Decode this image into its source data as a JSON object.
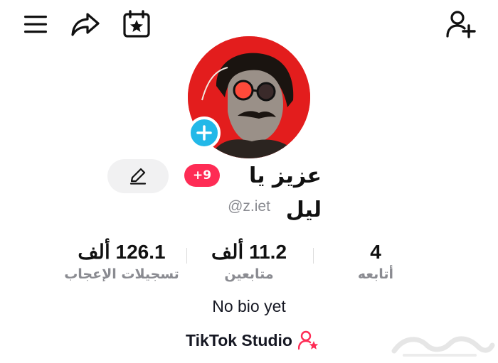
{
  "top_bar": {
    "menu_icon": "hamburger-menu-icon",
    "share_icon": "share-arrow-icon",
    "calendar_icon": "calendar-star-icon",
    "add_friend_icon": "add-user-icon"
  },
  "profile": {
    "display_name": "عزيز يا ليل",
    "notification_badge": "+9",
    "handle": "@z.iet",
    "bio": "No bio yet"
  },
  "stats": [
    {
      "value": "4",
      "label": "أتابعه"
    },
    {
      "value": "11.2 ألف",
      "label": "متابعين"
    },
    {
      "value": "126.1 ألف",
      "label": "تسجيلات الإعجاب"
    }
  ],
  "studio": {
    "label": "TikTok Studio",
    "icon": "user-star-icon"
  },
  "colors": {
    "accent_red": "#fe2c55",
    "add_blue": "#22b8e8",
    "avatar_bg": "#e31d1d",
    "muted": "#8a8b91"
  }
}
